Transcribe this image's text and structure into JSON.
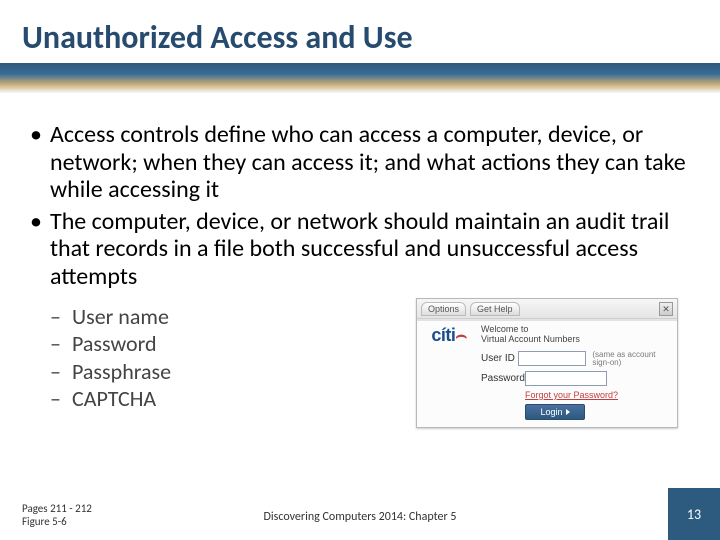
{
  "title": "Unauthorized Access and Use",
  "bullets": [
    "Access controls define who can access a computer, device, or network; when they can access it; and what actions they can take while accessing it",
    "The computer, device, or network should maintain an audit trail  that records in a file both successful and unsuccessful access attempts"
  ],
  "sub_bullets": [
    "User name",
    "Password",
    "Passphrase",
    "CAPTCHA"
  ],
  "footer": {
    "pages_ref_line1": "Pages 211 - 212",
    "pages_ref_line2": "Figure 5-6",
    "center": "Discovering Computers 2014: Chapter 5",
    "page_number": "13"
  },
  "login_widget": {
    "tabs": [
      "Options",
      "Get Help"
    ],
    "close_glyph": "✕",
    "brand": "cíti",
    "welcome_line1": "Welcome to",
    "welcome_line2": "Virtual Account Numbers",
    "userid_label": "User ID",
    "password_label": "Password",
    "userid_note": "(same as account sign-on)",
    "forgot": "Forgot your Password?",
    "login_label": "Login"
  }
}
